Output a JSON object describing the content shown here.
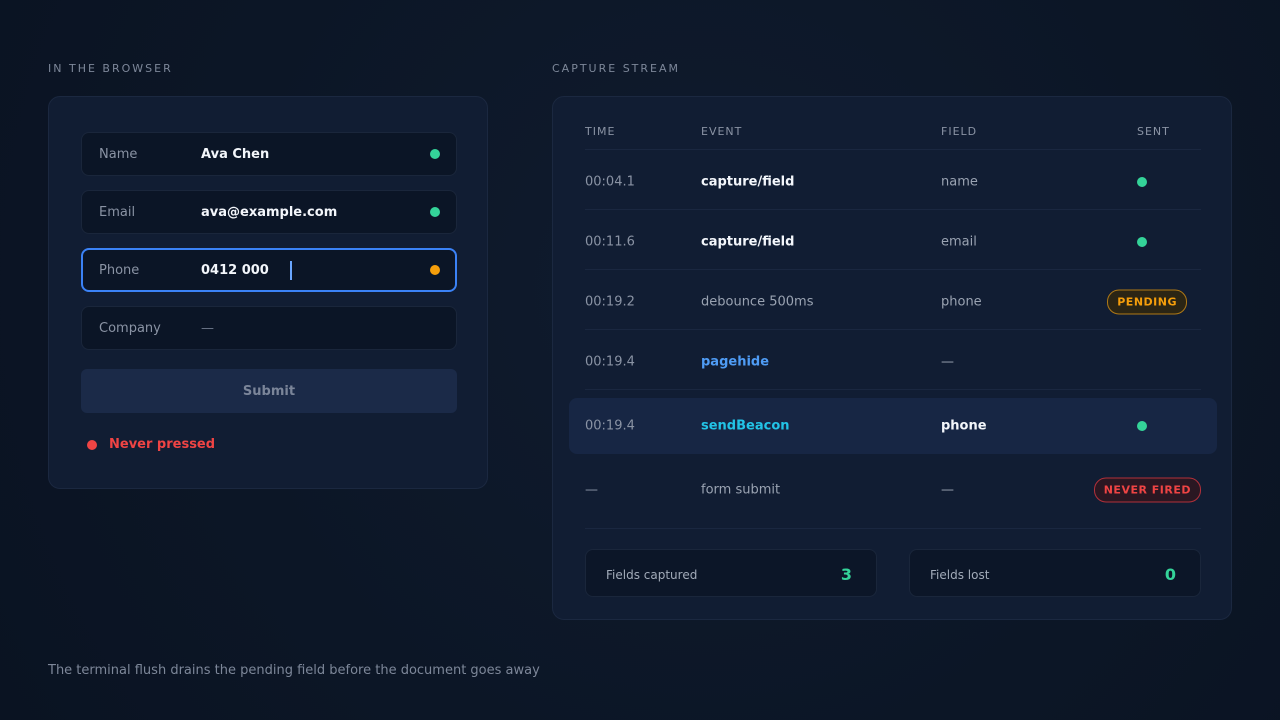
{
  "browser": {
    "label": "IN THE BROWSER",
    "fields": [
      {
        "label": "Name",
        "value": "Ava Chen",
        "status": "captured"
      },
      {
        "label": "Email",
        "value": "ava@example.com",
        "status": "captured"
      },
      {
        "label": "Phone",
        "value": "0412 000",
        "status": "pending",
        "focused": true
      },
      {
        "label": "Company",
        "value": "—",
        "status": "empty"
      }
    ],
    "submit_label": "Submit",
    "submit_status": "Never pressed"
  },
  "stream": {
    "label": "CAPTURE STREAM",
    "columns": [
      "TIME",
      "EVENT",
      "FIELD",
      "SENT"
    ],
    "rows": [
      {
        "time": "00:04.1",
        "event": "capture/field",
        "field": "name",
        "sent": "dot"
      },
      {
        "time": "00:11.6",
        "event": "capture/field",
        "field": "email",
        "sent": "dot"
      },
      {
        "time": "00:19.2",
        "event": "debounce 500ms",
        "field": "phone",
        "sent": "PENDING"
      },
      {
        "time": "00:19.4",
        "event": "pagehide",
        "field": "—",
        "sent": ""
      },
      {
        "time": "00:19.4",
        "event": "sendBeacon",
        "field": "phone",
        "sent": "dot",
        "highlighted": true
      },
      {
        "time": "—",
        "event": "form submit",
        "field": "—",
        "sent": "NEVER FIRED"
      }
    ],
    "stats": [
      {
        "label": "Fields captured",
        "value": "3"
      },
      {
        "label": "Fields lost",
        "value": "0"
      }
    ]
  },
  "caption": "The terminal flush drains the pending field before the document goes away",
  "colors": {
    "captured": "#34d399",
    "pending": "#f59e0b",
    "error": "#ef4444",
    "focus": "#3b82f6",
    "event_pagehide": "#4f9cf5",
    "event_beacon": "#22c3e6"
  }
}
